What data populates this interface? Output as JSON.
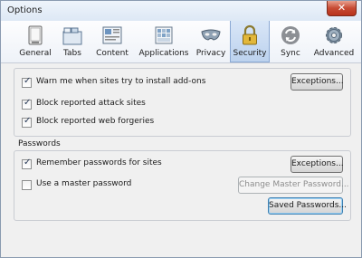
{
  "window": {
    "title": "Options",
    "close_glyph": "✕"
  },
  "toolbar": {
    "panes": [
      {
        "label": "General",
        "icon": "general-icon"
      },
      {
        "label": "Tabs",
        "icon": "tabs-icon"
      },
      {
        "label": "Content",
        "icon": "content-icon"
      },
      {
        "label": "Applications",
        "icon": "applications-icon"
      },
      {
        "label": "Privacy",
        "icon": "privacy-icon"
      },
      {
        "label": "Security",
        "icon": "security-icon",
        "selected": true
      },
      {
        "label": "Sync",
        "icon": "sync-icon"
      },
      {
        "label": "Advanced",
        "icon": "advanced-icon"
      }
    ]
  },
  "addons_group": {
    "warn_addons": {
      "label": "Warn me when sites try to install add-ons",
      "checked": true
    },
    "exceptions_label": "Exceptions...",
    "block_attack": {
      "label": "Block reported attack sites",
      "checked": true
    },
    "block_forgeries": {
      "label": "Block reported web forgeries",
      "checked": true
    }
  },
  "passwords_group": {
    "title": "Passwords",
    "remember": {
      "label": "Remember passwords for sites",
      "checked": true
    },
    "exceptions_label": "Exceptions...",
    "master": {
      "label": "Use a master password",
      "checked": false
    },
    "change_master_label": "Change Master Password...",
    "saved_label": "Saved Passwords..."
  },
  "colors": {
    "selected_pane": "#bcd2ee",
    "accent": "#3c7fb1"
  }
}
